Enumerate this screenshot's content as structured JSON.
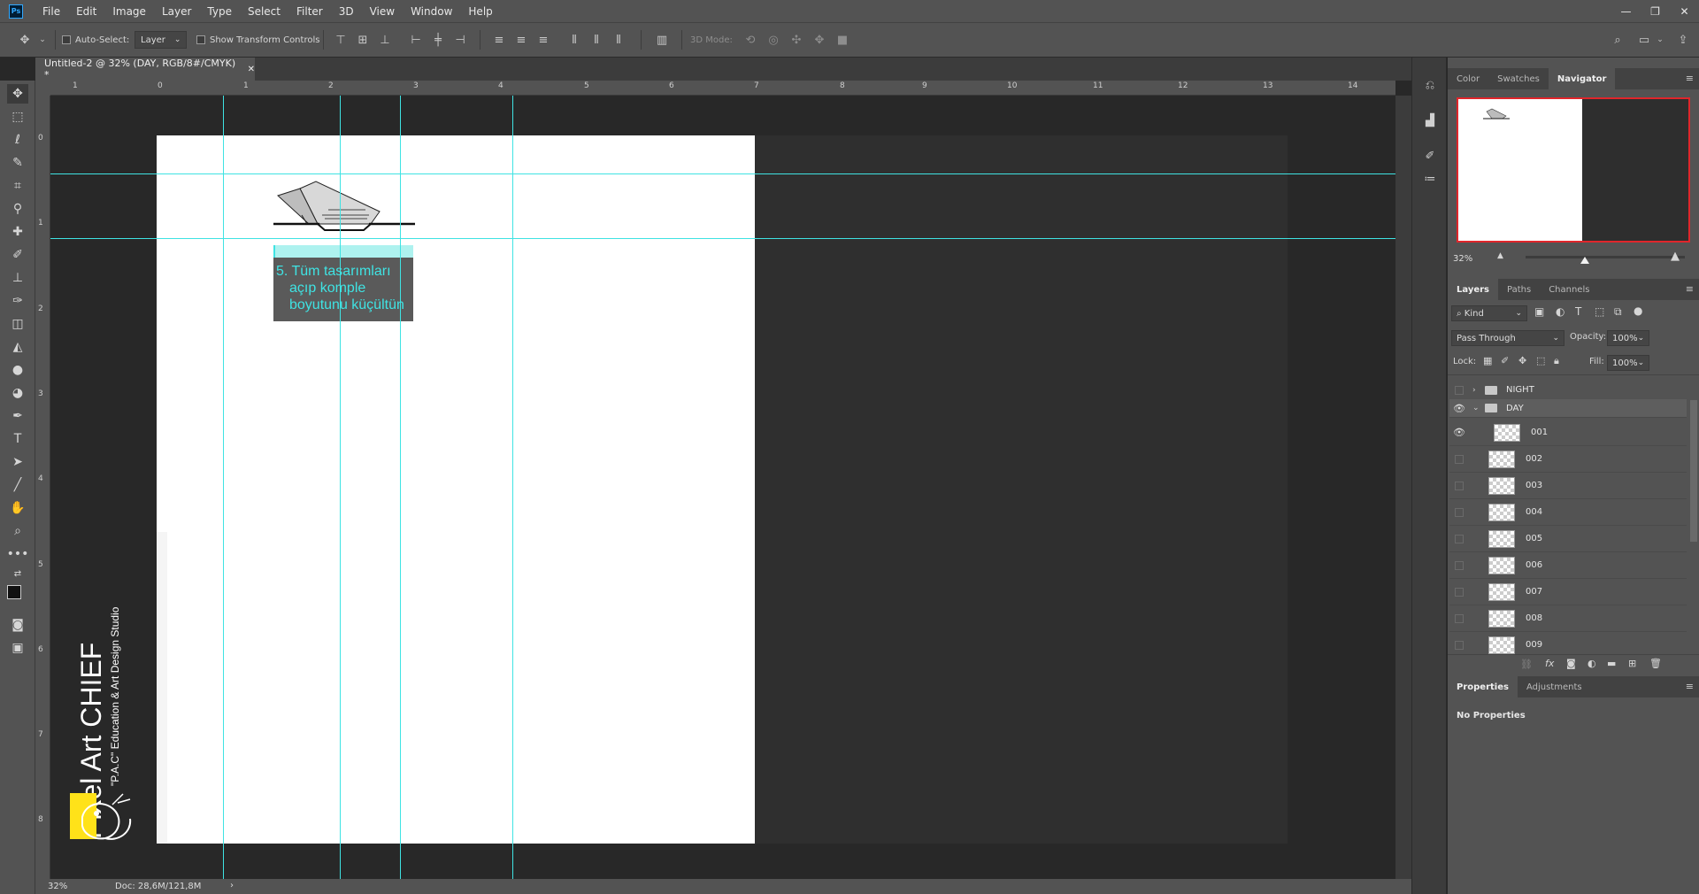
{
  "app": {
    "logo": "Ps"
  },
  "menu": [
    "File",
    "Edit",
    "Image",
    "Layer",
    "Type",
    "Select",
    "Filter",
    "3D",
    "View",
    "Window",
    "Help"
  ],
  "window_controls": {
    "minimize": "—",
    "restore": "❐",
    "close": "✕"
  },
  "options": {
    "auto_select_label": "Auto-Select:",
    "auto_select_value": "Layer",
    "show_transform_label": "Show Transform Controls",
    "mode_3d_label": "3D Mode:"
  },
  "document": {
    "tab_title": "Untitled-2 @ 32% (DAY, RGB/8#/CMYK) *",
    "annotation_lines": [
      "5. Tüm tasarımları",
      "açıp komple",
      "boyutunu küçültün"
    ],
    "watermark_title": "Pixel Art CHIEF",
    "watermark_subtitle": "\"P.A.C\" Education & Art Design Studio"
  },
  "ruler_top": [
    "1",
    "0",
    "1",
    "2",
    "3",
    "4",
    "5",
    "6",
    "7",
    "8",
    "9",
    "10",
    "11",
    "12",
    "13",
    "14"
  ],
  "ruler_left": [
    "0",
    "1",
    "2",
    "3",
    "4",
    "5",
    "6",
    "7",
    "8"
  ],
  "status": {
    "zoom": "32%",
    "doc": "Doc: 28,6M/121,8M"
  },
  "panels": {
    "top_tabs": [
      "Color",
      "Swatches",
      "Navigator"
    ],
    "navigator_zoom": "32%",
    "layers_tabs": [
      "Layers",
      "Paths",
      "Channels"
    ],
    "filter_kind": "Kind",
    "blend_mode": "Pass Through",
    "opacity_label": "Opacity:",
    "opacity_value": "100%",
    "lock_label": "Lock:",
    "fill_label": "Fill:",
    "fill_value": "100%",
    "layers": [
      {
        "name": "NIGHT",
        "type": "group",
        "visible": false,
        "expanded": false
      },
      {
        "name": "DAY",
        "type": "group",
        "visible": true,
        "expanded": true
      },
      {
        "name": "001",
        "type": "layer",
        "visible": true
      },
      {
        "name": "002",
        "type": "layer",
        "visible": false
      },
      {
        "name": "003",
        "type": "layer",
        "visible": false
      },
      {
        "name": "004",
        "type": "layer",
        "visible": false
      },
      {
        "name": "005",
        "type": "layer",
        "visible": false
      },
      {
        "name": "006",
        "type": "layer",
        "visible": false
      },
      {
        "name": "007",
        "type": "layer",
        "visible": false
      },
      {
        "name": "008",
        "type": "layer",
        "visible": false
      },
      {
        "name": "009",
        "type": "layer",
        "visible": false
      }
    ],
    "properties_tabs": [
      "Properties",
      "Adjustments"
    ],
    "properties_text": "No Properties"
  }
}
